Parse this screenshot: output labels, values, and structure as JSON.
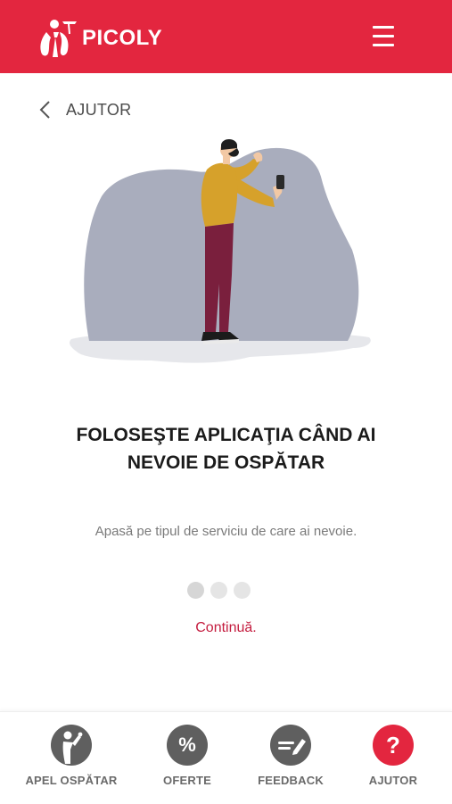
{
  "header": {
    "brand_name": "PICOLY",
    "menu_icon": "hamburger-menu-icon",
    "background_color": "#e3263f"
  },
  "nav_back": {
    "icon": "chevron-left-icon",
    "label": "AJUTOR"
  },
  "slide": {
    "title_line1": "FOLOSEŞTE APLICAŢIA CÂND AI",
    "title_line2": "NEVOIE DE OSPĂTAR",
    "description": "Apasă pe tipul de serviciu de care ai nevoie.",
    "illustration": "man-using-phone-illustration",
    "pagination": {
      "total": 3,
      "current": 1
    },
    "continue_label": "Continuă."
  },
  "bottom_nav": {
    "items": [
      {
        "label": "APEL OSPĂTAR",
        "icon": "waiter-call-icon",
        "active": false
      },
      {
        "label": "OFERTE",
        "icon": "percent-icon",
        "active": false
      },
      {
        "label": "FEEDBACK",
        "icon": "feedback-pen-icon",
        "active": false
      },
      {
        "label": "AJUTOR",
        "icon": "question-mark-icon",
        "active": true
      }
    ]
  },
  "colors": {
    "accent": "#e3263f",
    "link": "#c41d3f",
    "nav_icon_inactive": "#5f5f5f"
  }
}
